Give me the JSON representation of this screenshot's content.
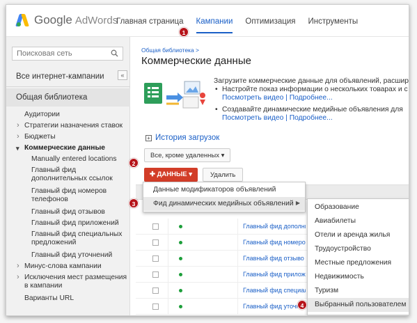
{
  "app": {
    "logo_google": "Google",
    "logo_product": "AdWords"
  },
  "nav": [
    "Главная страница",
    "Кампании",
    "Оптимизация",
    "Инструменты"
  ],
  "sidebar": {
    "search_placeholder": "Поисковая сеть",
    "all_campaigns": "Все интернет-кампании",
    "collapse": "«",
    "library": "Общая библиотека",
    "tree": [
      "Аудитории",
      "Стратегии назначения ставок",
      "Бюджеты",
      "Коммерческие данные",
      "Manually entered locations",
      "Главный фид дополнительных ссылок",
      "Главный фид номеров телефонов",
      "Главный фид отзывов",
      "Главный фид приложений",
      "Главный фид специальных предложений",
      "Главный фид уточнений",
      "Минус-слова кампании",
      "Исключения мест размещения в кампании",
      "Варианты URL"
    ]
  },
  "main": {
    "breadcrumb": "Общая библиотека >",
    "title": "Коммерческие данные",
    "promo": {
      "intro": "Загрузите коммерческие данные для объявлений, расширени",
      "bullet1": "Настройте показ информации о нескольких товарах и с",
      "links1": "Посмотреть видео | Подробнее...",
      "bullet2": "Создавайте динамические медийные объявления для",
      "links2": "Посмотреть видео | Подробнее..."
    },
    "history": "История загрузок",
    "filter": "Все, кроме удаленных",
    "data_button": "ДАННЫЕ",
    "delete_button": "Удалить",
    "rows": [
      "Главный фид дополни",
      "Главный фид номеро",
      "Главный фид отзыво",
      "Главный фид прилож",
      "Главный фид специал",
      "Главный фид уточнен"
    ]
  },
  "menu1": [
    "Данные модификаторов объявлений",
    "Фид динамических медийных объявлений"
  ],
  "menu2": [
    "Образование",
    "Авиабилеты",
    "Отели и аренда жилья",
    "Трудоустройство",
    "Местные предложения",
    "Недвижимость",
    "Туризм",
    "Выбранный пользователем"
  ],
  "badges": [
    "1",
    "2",
    "3",
    "4"
  ],
  "colors": {
    "accent": "#1a5fc7",
    "danger": "#d23d28",
    "badge": "#b6141a",
    "status_green": "#1d9e3a"
  }
}
